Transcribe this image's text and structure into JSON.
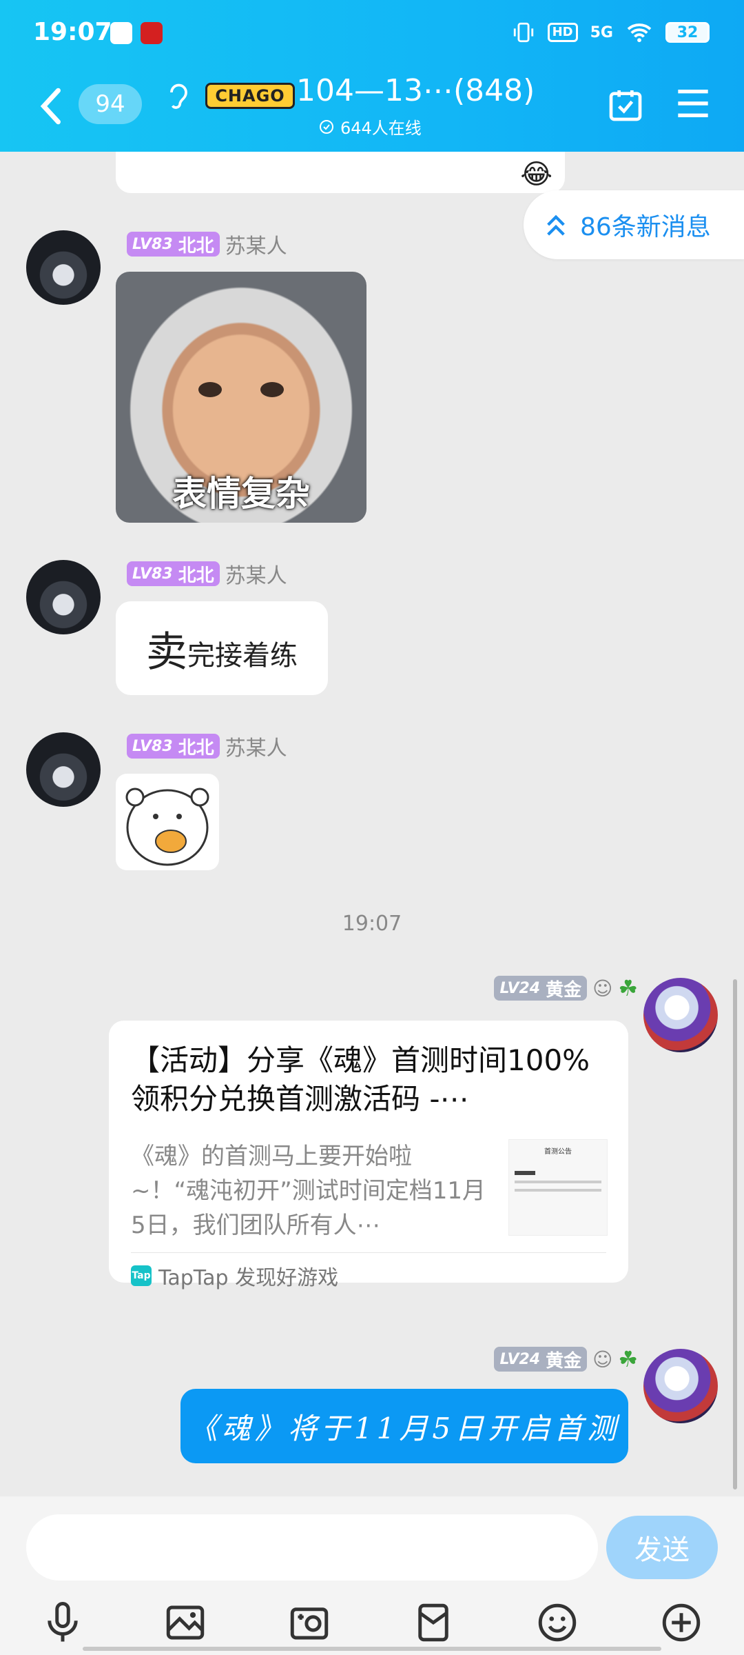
{
  "status_bar": {
    "time": "19:07",
    "signal": "5G",
    "hd": "HD",
    "battery": "32"
  },
  "header": {
    "unread_count": "94",
    "logo_text": "CHAGO",
    "title": "104—13⋯(848)",
    "online": "644人在线"
  },
  "new_messages": "86条新消息",
  "messages": [
    {
      "level": "LV83",
      "tag": "北北",
      "sender": "苏某人",
      "type": "sticker",
      "caption": "表情复杂"
    },
    {
      "level": "LV83",
      "tag": "北北",
      "sender": "苏某人",
      "type": "text",
      "text_big": "卖",
      "text_small": "完接着练"
    },
    {
      "level": "LV83",
      "tag": "北北",
      "sender": "苏某人",
      "type": "sticker",
      "caption": ""
    }
  ],
  "time_separator": "19:07",
  "share_card": {
    "level": "LV24",
    "tag": "黄金",
    "title": "【活动】分享《魂》首测时间100%领积分兑换首测激活码 -⋯",
    "desc": "《魂》的首测马上要开始啦~！“魂沌初开”测试时间定档11月5日，我们团队所有人⋯",
    "thumb_title": "首测公告",
    "source": "TapTap 发现好游戏",
    "source_icon": "Tap"
  },
  "my_message": {
    "level": "LV24",
    "tag": "黄金",
    "text": "《魂》将于11月5日开启首测"
  },
  "send_label": "发送",
  "colors": {
    "header": "#12b6f6",
    "accent": "#0b99f4",
    "level_purple": "#c58af3",
    "level_gray": "#a9b0c0"
  }
}
